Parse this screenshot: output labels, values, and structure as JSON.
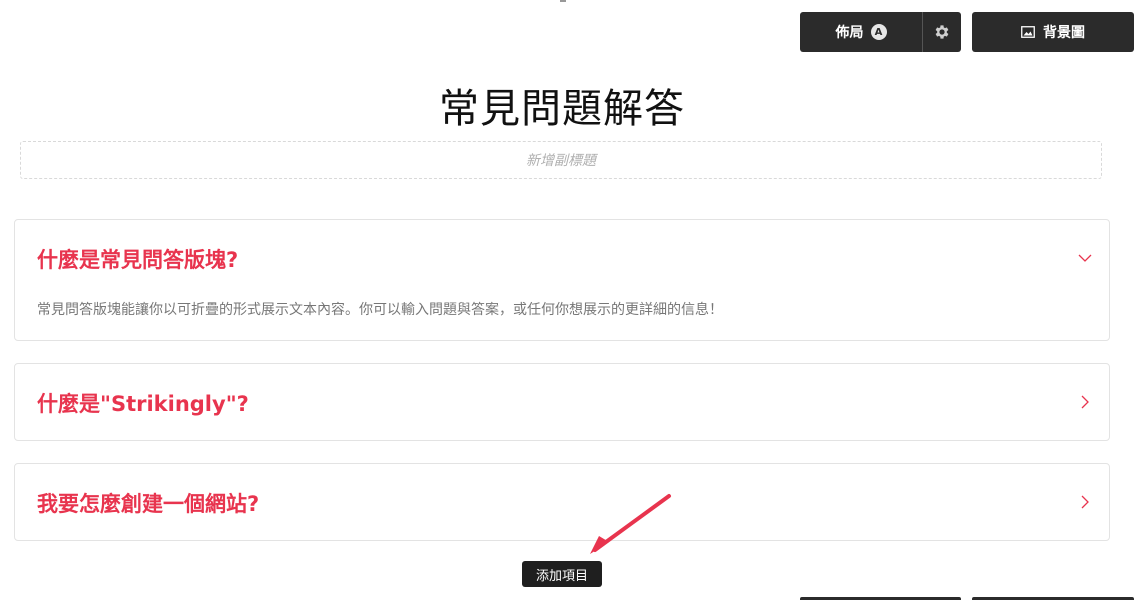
{
  "toolbar": {
    "layout_label": "佈局",
    "layout_badge": "A",
    "settings_icon": "gear-icon",
    "background_label": "背景圖",
    "background_icon": "image-icon"
  },
  "section": {
    "title": "常見問題解答",
    "subtitle_placeholder": "新增副標題"
  },
  "faq": {
    "items": [
      {
        "question": "什麼是常見問答版塊?",
        "answer": "常見問答版塊能讓你以可折疊的形式展示文本內容。你可以輸入問題與答案，或任何你想展示的更詳細的信息！",
        "expanded": true,
        "icon": "chevron-down-icon"
      },
      {
        "question": "什麼是\"Strikingly\"?",
        "expanded": false,
        "icon": "chevron-right-icon"
      },
      {
        "question": "我要怎麼創建一個網站?",
        "expanded": false,
        "icon": "chevron-right-icon"
      }
    ]
  },
  "add_item": {
    "label": "添加項目"
  },
  "colors": {
    "accent": "#e8344e",
    "toolbar_bg": "#2b2b2b",
    "annotation_arrow": "#e8344e"
  }
}
